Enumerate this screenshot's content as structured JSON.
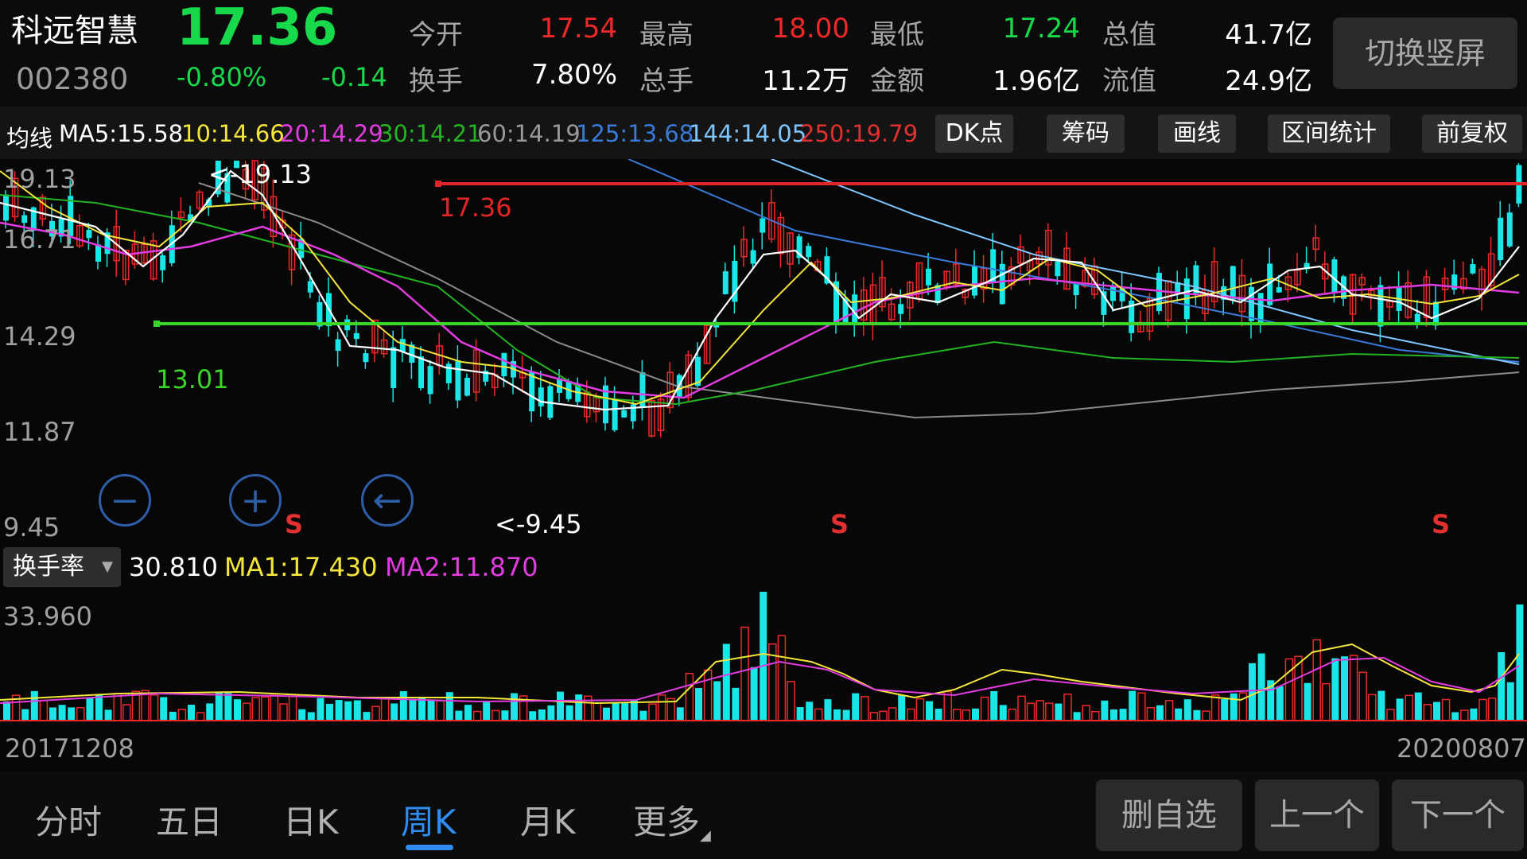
{
  "header": {
    "name": "科远智慧",
    "code": "002380",
    "price": "17.36",
    "change_pct": "-0.80%",
    "change": "-0.14",
    "quotes": [
      {
        "label": "今开",
        "value": "17.54",
        "color": "#f02828"
      },
      {
        "label": "最高",
        "value": "18.00",
        "color": "#f02828"
      },
      {
        "label": "最低",
        "value": "17.24",
        "color": "#17d94a"
      },
      {
        "label": "总值",
        "value": "41.7亿",
        "color": "#ffffff"
      },
      {
        "label": "换手",
        "value": "7.80%",
        "color": "#ffffff"
      },
      {
        "label": "总手",
        "value": "11.2万",
        "color": "#ffffff"
      },
      {
        "label": "金额",
        "value": "1.96亿",
        "color": "#ffffff"
      },
      {
        "label": "流值",
        "value": "24.9亿",
        "color": "#ffffff"
      }
    ],
    "switch_button": "切换竖屏"
  },
  "ma_row": {
    "label": "均线",
    "items": [
      {
        "text": "MA5:15.58",
        "color": "#ffffff"
      },
      {
        "text": "10:14.66",
        "color": "#f5e63c"
      },
      {
        "text": "20:14.29",
        "color": "#e23ce0"
      },
      {
        "text": "30:14.21",
        "color": "#22b422"
      },
      {
        "text": "60:14.19",
        "color": "#9a9a9a"
      },
      {
        "text": "125:13.68",
        "color": "#3a7ad8"
      },
      {
        "text": "144:14.05",
        "color": "#7fc6ff"
      },
      {
        "text": "250:19.79",
        "color": "#e23030"
      }
    ],
    "tools": [
      "DK点",
      "筹码",
      "画线",
      "区间统计",
      "前复权"
    ]
  },
  "chart": {
    "y_ticks": [
      "19.13",
      "16.71",
      "14.29",
      "11.87",
      "9.45"
    ],
    "high_marker": "<-19.13",
    "low_marker": "<-9.45",
    "red_line_label": "17.36",
    "green_line_label": "13.01",
    "s_marks": [
      "S",
      "S",
      "S"
    ],
    "controls": {
      "zoom_out": "−",
      "zoom_in": "+",
      "back": "←"
    }
  },
  "volume": {
    "indicator": "换手率",
    "value": "30.810",
    "ma1": "MA1:17.430",
    "ma2": "MA2:11.870",
    "max_tick": "33.960",
    "date_start": "20171208",
    "date_end": "20200807"
  },
  "tabs": [
    "分时",
    "五日",
    "日K",
    "周K",
    "月K",
    "更多"
  ],
  "active_tab": "周K",
  "bottom_buttons": [
    "删自选",
    "上一个",
    "下一个"
  ],
  "colors": {
    "up": "#f02828",
    "down": "#17d94a",
    "accent": "#2f8cf2"
  }
}
